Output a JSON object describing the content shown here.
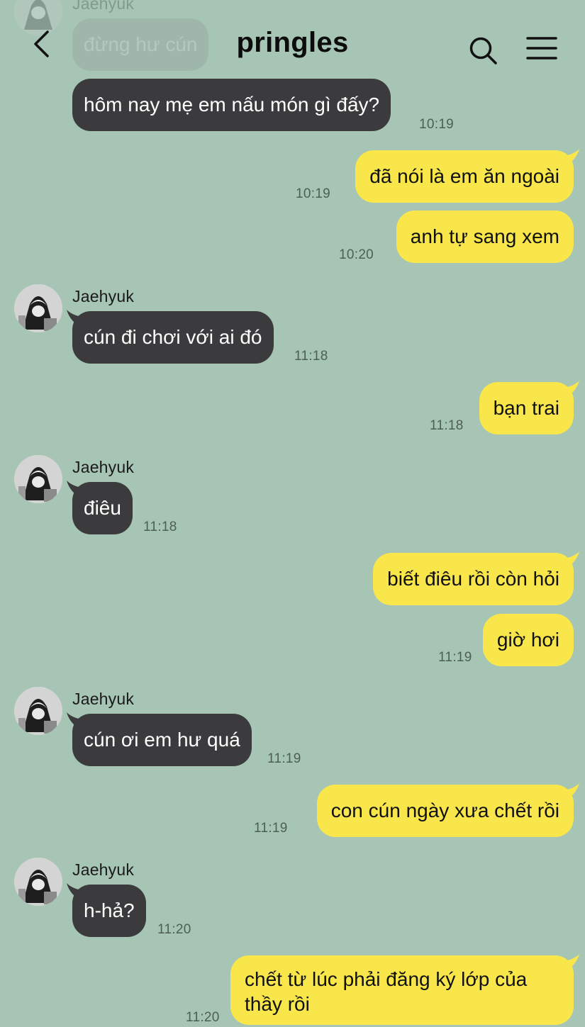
{
  "header": {
    "title": "pringles",
    "back_icon": "chevron-left-icon",
    "search_icon": "search-icon",
    "menu_icon": "menu-icon"
  },
  "colors": {
    "background": "#a7c5b5",
    "incoming_bubble": "#3b3b3e",
    "outgoing_bubble": "#f8e64b"
  },
  "messages": [
    {
      "sender": "Jaehyuk",
      "text": "đừng hư cún",
      "time": ""
    },
    {
      "sender": "",
      "text": "hôm nay mẹ em nấu món gì đấy?",
      "time": "10:19"
    },
    {
      "sender": "",
      "text": "đã nói là em ăn ngoài",
      "time": "10:19"
    },
    {
      "sender": "",
      "text": "anh tự sang xem",
      "time": "10:20"
    },
    {
      "sender": "Jaehyuk",
      "text": "cún đi chơi với ai đó",
      "time": "11:18"
    },
    {
      "sender": "",
      "text": "bạn trai",
      "time": "11:18"
    },
    {
      "sender": "Jaehyuk",
      "text": "điêu",
      "time": "11:18"
    },
    {
      "sender": "",
      "text": "biết điêu rồi còn hỏi",
      "time": ""
    },
    {
      "sender": "",
      "text": "giờ hơi",
      "time": "11:19"
    },
    {
      "sender": "Jaehyuk",
      "text": "cún ơi em hư quá",
      "time": "11:19"
    },
    {
      "sender": "",
      "text": "con cún ngày xưa chết rồi",
      "time": "11:19"
    },
    {
      "sender": "Jaehyuk",
      "text": "h-hả?",
      "time": "11:20"
    },
    {
      "sender": "",
      "text": "chết từ lúc phải đăng ký lớp của thầy rồi",
      "time": "11:20"
    }
  ]
}
